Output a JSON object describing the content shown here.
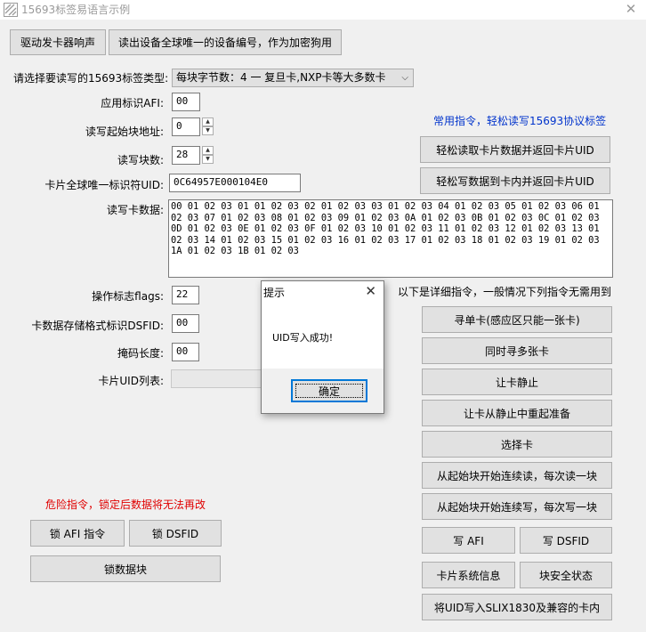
{
  "window": {
    "title": "15693标签易语言示例",
    "close_glyph": "✕"
  },
  "top_buttons": {
    "beep": "驱动发卡器响声",
    "read_device_id": "读出设备全球唯一的设备编号，作为加密狗用"
  },
  "form": {
    "tag_type_label": "请选择要读写的15693标签类型:",
    "tag_type_value": "每块字节数：4 一 复旦卡,NXP卡等大多数卡",
    "afi_label": "应用标识AFI:",
    "afi_value": "00",
    "start_block_label": "读写起始块地址:",
    "start_block_value": "0",
    "block_count_label": "读写块数:",
    "block_count_value": "28",
    "uid_label": "卡片全球唯一标识符UID:",
    "uid_value": "0C64957E000104E0",
    "card_data_label": "读写卡数据:",
    "card_data_value": "00 01 02 03 01 01 02 03 02 01 02 03 03 01 02 03 04 01 02 03 05 01 02 03 06 01 02 03 07 01 02 03 08 01 02 03 09 01 02 03 0A 01 02 03 0B 01 02 03 0C 01 02 03 0D 01 02 03 0E 01 02 03 0F 01 02 03 10 01 02 03 11 01 02 03 12 01 02 03 13 01 02 03 14 01 02 03 15 01 02 03 16 01 02 03 17 01 02 03 18 01 02 03 19 01 02 03 1A 01 02 03 1B 01 02 03",
    "flags_label": "操作标志flags:",
    "flags_value": "22",
    "dsfid_label": "卡数据存储格式标识DSFID:",
    "dsfid_value": "00",
    "mask_len_label": "掩码长度:",
    "mask_len_value": "00",
    "uid_list_label": "卡片UID列表:"
  },
  "common": {
    "heading": "常用指令，轻松读写15693协议标签",
    "easy_read": "轻松读取卡片数据并返回卡片UID",
    "easy_write": "轻松写数据到卡内并返回卡片UID"
  },
  "detail": {
    "heading": "以下是详细指令，一般情况下列指令无需用到",
    "find_single": "寻单卡(感应区只能一张卡)",
    "find_multi": "同时寻多张卡",
    "quiet": "让卡静止",
    "ready": "让卡从静止中重起准备",
    "select": "选择卡",
    "read_blocks": "从起始块开始连续读，每次读一块",
    "write_blocks": "从起始块开始连续写，每次写一块",
    "write_afi": "写 AFI",
    "write_dsfid": "写 DSFID",
    "system_info": "卡片系统信息",
    "security_status": "块安全状态",
    "write_uid": "将UID写入SLIX1830及兼容的卡内"
  },
  "danger": {
    "warning": "危险指令，锁定后数据将无法再改",
    "lock_afi": "锁 AFI 指令",
    "lock_dsfid": "锁  DSFID",
    "lock_block": "锁数据块"
  },
  "dialog": {
    "title": "提示",
    "message": "UID写入成功!",
    "ok": "确定"
  },
  "colors": {
    "blue_text": "#0033cc",
    "red_text": "#e00000",
    "focus_blue": "#0078d7"
  }
}
